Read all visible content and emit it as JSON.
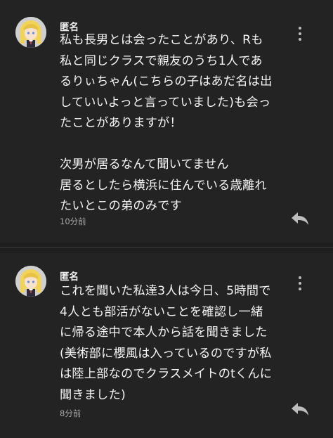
{
  "comments": [
    {
      "author": "匿名",
      "avatar_icon": "anime-girl-avatar-icon",
      "lines": [
        "私も長男とは会ったことがあり、Rも",
        "私と同じクラスで親友のうち1人であ",
        "るりぃちゃん(こちらの子はあだ名は出",
        "していいよっと言っていました)も会っ",
        "たことがありますが！",
        "",
        "次男が居るなんて聞いてません",
        "居るとしたら横浜に住んでいる歳離れ",
        "たいとこの弟のみです"
      ],
      "time": "10分前",
      "menu_icon": "more-vert-icon",
      "reply_icon": "reply-icon"
    },
    {
      "author": "匿名",
      "avatar_icon": "anime-girl-avatar-icon",
      "lines": [
        "これを聞いた私達3人は今日、5時間で",
        "4人とも部活がないことを確認し一緒",
        "に帰る途中で本人から話を聞きました",
        "(美術部に櫻風は入っているのですが私",
        "は陸上部なのでクラスメイトのtくんに",
        "聞きました)"
      ],
      "time": "8分前",
      "menu_icon": "more-vert-icon",
      "reply_icon": "reply-icon"
    }
  ],
  "colors": {
    "background": "#1f1f1f",
    "card": "#232323",
    "text": "#f4f4f4",
    "muted": "#a8a8a8",
    "icon": "#bdbdbd"
  }
}
